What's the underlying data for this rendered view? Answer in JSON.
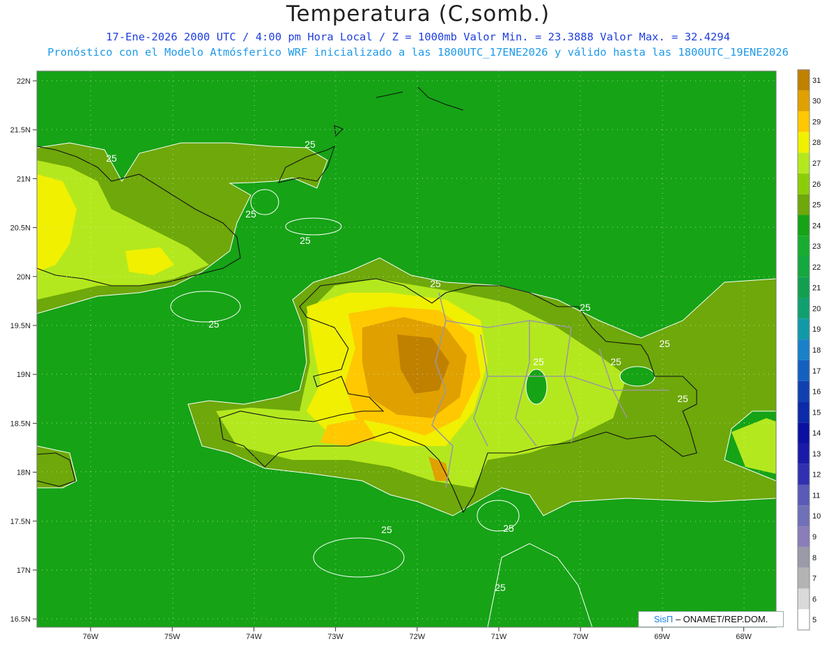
{
  "header": {
    "title": "Temperatura (C,somb.)",
    "line1": "17-Ene-2026  2000 UTC / 4:00 pm Hora Local / Z = 1000mb   Valor Min. = 23.3888  Valor Max. = 32.4294",
    "line2": "Pronóstico con el Modelo Atmósferico WRF inicializado a las 1800UTC_17ENE2026 y válido hasta las  1800UTC_19ENE2026"
  },
  "axes": {
    "lat_labels": [
      "22N",
      "21.5N",
      "21N",
      "20.5N",
      "20N",
      "19.5N",
      "19N",
      "18.5N",
      "18N",
      "17.5N",
      "17N",
      "16.5N"
    ],
    "lon_labels": [
      "76W",
      "75W",
      "74W",
      "73W",
      "72W",
      "71W",
      "70W",
      "69W",
      "68W"
    ]
  },
  "colorbar": {
    "labels": [
      "5",
      "6",
      "7",
      "8",
      "9",
      "10",
      "11",
      "12",
      "13",
      "14",
      "15",
      "16",
      "17",
      "18",
      "19",
      "20",
      "21",
      "22",
      "23",
      "24",
      "25",
      "26",
      "27",
      "28",
      "29",
      "30",
      "31"
    ],
    "colors": [
      "#ffffff",
      "#d9d9d9",
      "#b3b3b3",
      "#9a9aa8",
      "#8a7db8",
      "#7070b8",
      "#5a5ab8",
      "#3030b0",
      "#1a1aa8",
      "#0a10a0",
      "#0a2aa8",
      "#1040b0",
      "#1460c0",
      "#1a80c8",
      "#109aa8",
      "#10a070",
      "#10a050",
      "#14a840",
      "#18ad30",
      "#16a316",
      "#6ea80a",
      "#8ccd0a",
      "#b4e81e",
      "#f0f000",
      "#ffc800",
      "#e0a000",
      "#c08000"
    ]
  },
  "colors": {
    "water": "#16a316",
    "land_base": "#6ea80a",
    "warm": "#b4e81e",
    "hot": "#f0f000",
    "hotter": "#ffc800",
    "hottest": "#e0a000",
    "peak": "#c08000"
  },
  "contour_labels": [
    "25",
    "25",
    "25",
    "25",
    "25",
    "25",
    "25",
    "25",
    "25",
    "25",
    "25",
    "25",
    "25",
    "25"
  ],
  "credit": {
    "sis": "SisΠ",
    "org": "– ONAMET/REP.DOM."
  }
}
